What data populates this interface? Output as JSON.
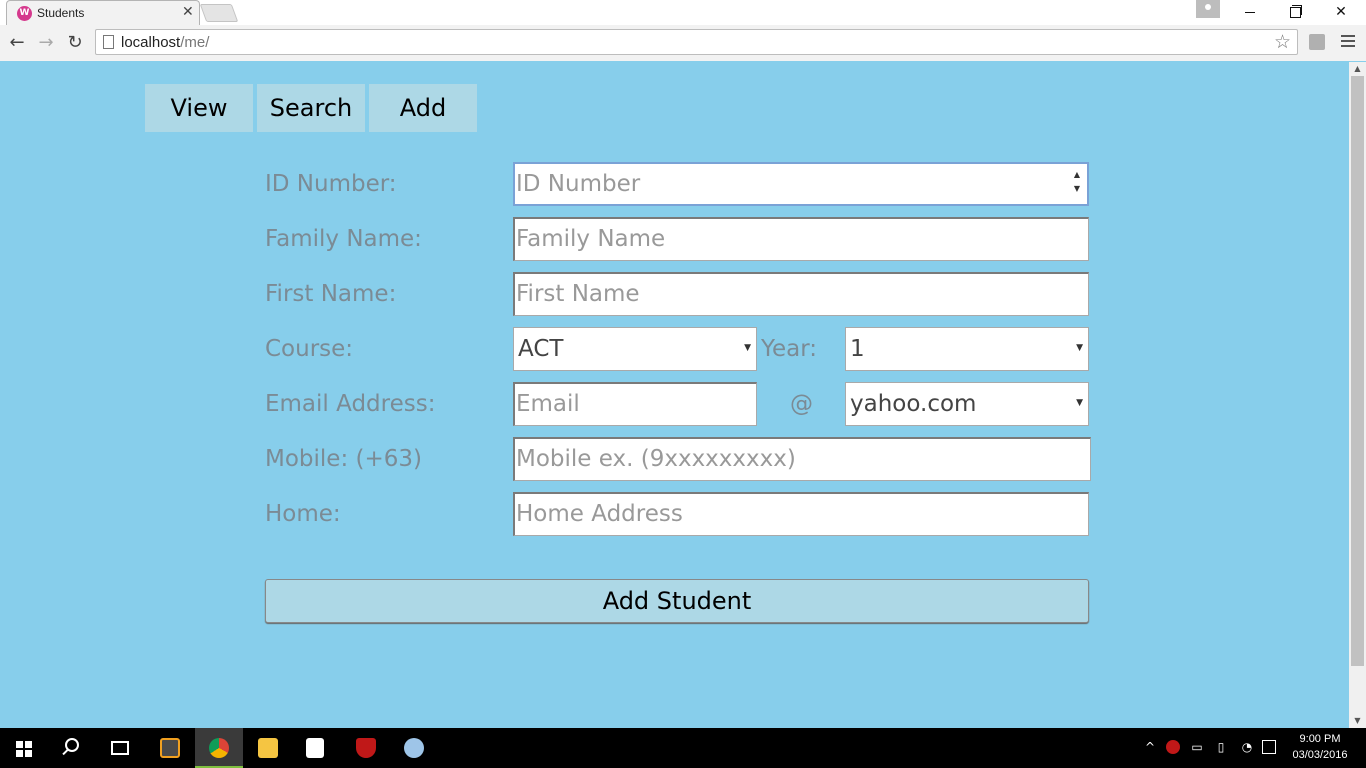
{
  "browser": {
    "tab_title": "Students",
    "tab_favicon_letter": "W",
    "url_host": "localhost",
    "url_path": "/me/"
  },
  "nav": {
    "view_label": "View",
    "search_label": "Search",
    "add_label": "Add"
  },
  "form": {
    "id_label": "ID Number:",
    "id_placeholder": "ID Number",
    "family_label": "Family Name:",
    "family_placeholder": "Family Name",
    "first_label": "First Name:",
    "first_placeholder": "First Name",
    "course_label": "Course:",
    "course_value": "ACT",
    "year_label": "Year:",
    "year_value": "1",
    "email_label": "Email Address:",
    "email_placeholder": "Email",
    "email_at": "@",
    "email_domain_value": "yahoo.com",
    "mobile_label": "Mobile: (+63)",
    "mobile_placeholder": "Mobile ex. (9xxxxxxxxx)",
    "home_label": "Home:",
    "home_placeholder": "Home Address",
    "submit_label": "Add Student"
  },
  "taskbar": {
    "time": "9:00 PM",
    "date": "03/03/2016"
  },
  "colors": {
    "page_background": "#87ceeb",
    "nav_button_background": "#add8e6",
    "label_text": "#7b8b95"
  }
}
